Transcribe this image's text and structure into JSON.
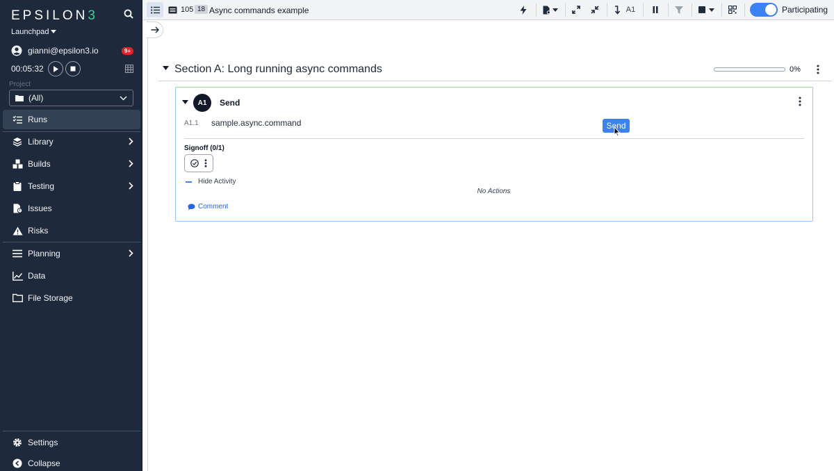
{
  "sidebar": {
    "logo": {
      "main": "EPSILON",
      "accent": "3"
    },
    "workspace": "Launchpad",
    "user": {
      "email": "gianni@epsilon3.io",
      "notifications": "9+"
    },
    "timer": "00:05:32",
    "project": {
      "label": "Project",
      "value": "(All)"
    },
    "nav": [
      {
        "label": "Runs",
        "icon": "checklist-icon",
        "active": true
      },
      {
        "label": "Library",
        "icon": "layers-icon",
        "chevron": true
      },
      {
        "label": "Builds",
        "icon": "cubes-icon",
        "chevron": true
      },
      {
        "label": "Testing",
        "icon": "clipboard-icon",
        "chevron": true
      },
      {
        "label": "Issues",
        "icon": "file-alert-icon"
      },
      {
        "label": "Risks",
        "icon": "warning-icon"
      },
      {
        "label": "Planning",
        "icon": "bars-icon",
        "chevron": true
      },
      {
        "label": "Data",
        "icon": "chart-line-icon"
      },
      {
        "label": "File Storage",
        "icon": "folder-icon"
      }
    ],
    "footer": [
      {
        "label": "Settings",
        "icon": "gear-icon"
      },
      {
        "label": "Collapse",
        "icon": "arrow-left-circle-icon"
      }
    ]
  },
  "toolbar": {
    "run_number": "105",
    "revision": "18",
    "title": "Async commands example",
    "jump_label": "A1",
    "participating_label": "Participating",
    "participating": true
  },
  "section": {
    "title": "Section A: Long running async commands",
    "progress_percent": 0,
    "progress_label": "0%"
  },
  "step": {
    "id": "A1",
    "name": "Send",
    "command": {
      "index": "A1.1",
      "name": "sample.async.command",
      "button_label": "Send"
    },
    "signoff_label": "Signoff (0/1)",
    "activity_toggle_label": "Hide Activity",
    "no_actions_label": "No Actions",
    "comment_label": "Comment"
  },
  "colors": {
    "sidebar_bg": "#1e293b",
    "accent": "#3b82f6",
    "logo_accent": "#34d399",
    "badge": "#dc2626"
  }
}
